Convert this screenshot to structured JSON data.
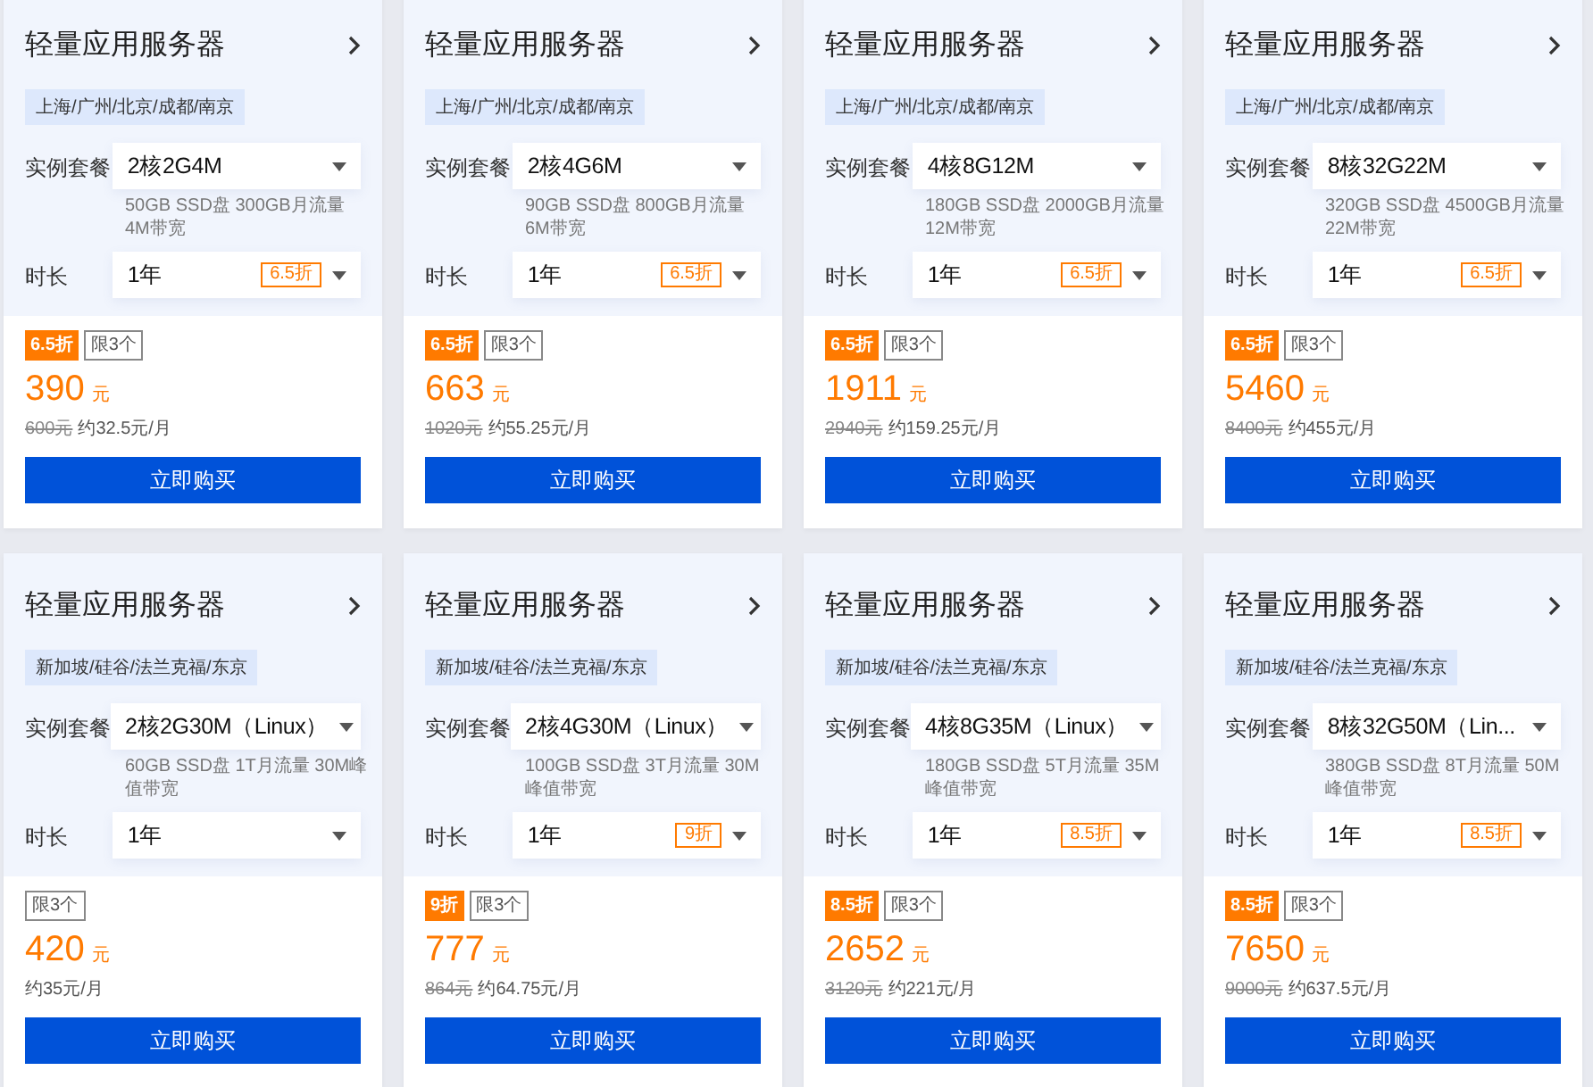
{
  "cards": [
    {
      "title": "轻量应用服务器",
      "region": "上海/广州/北京/成都/南京",
      "plan_label": "实例套餐",
      "plan": "2核2G4M",
      "spec": "50GB SSD盘 300GB月流量 4M带宽",
      "duration_label": "时长",
      "duration": "1年",
      "duration_discount": "6.5折",
      "discount": "6.5折",
      "limit": "限3个",
      "price": "390",
      "unit": "元",
      "original_price": "600元",
      "monthly": "约32.5元/月",
      "button": "立即购买"
    },
    {
      "title": "轻量应用服务器",
      "region": "上海/广州/北京/成都/南京",
      "plan_label": "实例套餐",
      "plan": "2核4G6M",
      "spec": "90GB SSD盘 800GB月流量 6M带宽",
      "duration_label": "时长",
      "duration": "1年",
      "duration_discount": "6.5折",
      "discount": "6.5折",
      "limit": "限3个",
      "price": "663",
      "unit": "元",
      "original_price": "1020元",
      "monthly": "约55.25元/月",
      "button": "立即购买"
    },
    {
      "title": "轻量应用服务器",
      "region": "上海/广州/北京/成都/南京",
      "plan_label": "实例套餐",
      "plan": "4核8G12M",
      "spec": "180GB SSD盘 2000GB月流量 12M带宽",
      "duration_label": "时长",
      "duration": "1年",
      "duration_discount": "6.5折",
      "discount": "6.5折",
      "limit": "限3个",
      "price": "1911",
      "unit": "元",
      "original_price": "2940元",
      "monthly": "约159.25元/月",
      "button": "立即购买"
    },
    {
      "title": "轻量应用服务器",
      "region": "上海/广州/北京/成都/南京",
      "plan_label": "实例套餐",
      "plan": "8核32G22M",
      "spec": "320GB SSD盘 4500GB月流量 22M带宽",
      "duration_label": "时长",
      "duration": "1年",
      "duration_discount": "6.5折",
      "discount": "6.5折",
      "limit": "限3个",
      "price": "5460",
      "unit": "元",
      "original_price": "8400元",
      "monthly": "约455元/月",
      "button": "立即购买"
    },
    {
      "title": "轻量应用服务器",
      "region": "新加坡/硅谷/法兰克福/东京",
      "plan_label": "实例套餐",
      "plan": "2核2G30M（Linux）",
      "spec": "60GB SSD盘 1T月流量 30M峰值带宽",
      "duration_label": "时长",
      "duration": "1年",
      "limit": "限3个",
      "price": "420",
      "unit": "元",
      "monthly": "约35元/月",
      "button": "立即购买"
    },
    {
      "title": "轻量应用服务器",
      "region": "新加坡/硅谷/法兰克福/东京",
      "plan_label": "实例套餐",
      "plan": "2核4G30M（Linux）",
      "spec": "100GB SSD盘 3T月流量 30M峰值带宽",
      "duration_label": "时长",
      "duration": "1年",
      "duration_discount": "9折",
      "discount": "9折",
      "limit": "限3个",
      "price": "777",
      "unit": "元",
      "original_price": "864元",
      "monthly": "约64.75元/月",
      "button": "立即购买"
    },
    {
      "title": "轻量应用服务器",
      "region": "新加坡/硅谷/法兰克福/东京",
      "plan_label": "实例套餐",
      "plan": "4核8G35M（Linux）",
      "spec": "180GB SSD盘 5T月流量 35M峰值带宽",
      "duration_label": "时长",
      "duration": "1年",
      "duration_discount": "8.5折",
      "discount": "8.5折",
      "limit": "限3个",
      "price": "2652",
      "unit": "元",
      "original_price": "3120元",
      "monthly": "约221元/月",
      "button": "立即购买"
    },
    {
      "title": "轻量应用服务器",
      "region": "新加坡/硅谷/法兰克福/东京",
      "plan_label": "实例套餐",
      "plan": "8核32G50M（Lin...",
      "spec": "380GB SSD盘 8T月流量 50M峰值带宽",
      "duration_label": "时长",
      "duration": "1年",
      "duration_discount": "8.5折",
      "discount": "8.5折",
      "limit": "限3个",
      "price": "7650",
      "unit": "元",
      "original_price": "9000元",
      "monthly": "约637.5元/月",
      "button": "立即购买"
    }
  ]
}
